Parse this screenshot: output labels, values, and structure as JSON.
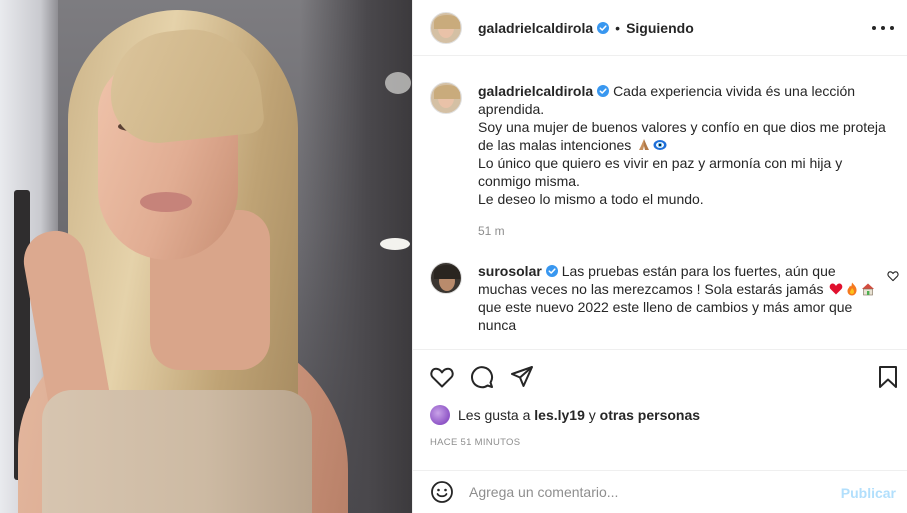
{
  "header": {
    "username": "galadrielcaldirola",
    "separator": "•",
    "follow_status": "Siguiendo"
  },
  "caption": {
    "username": "galadrielcaldirola",
    "lines": [
      "Cada experiencia vivida és una lección",
      "aprendida.",
      "Soy una mujer de buenos valores y confío en que dios me proteja",
      "de las malas intenciones",
      "Lo único que quiero es vivir en paz y armonía con mi hija y",
      "conmigo misma.",
      "Le deseo lo mismo a todo el mundo."
    ],
    "time": "51 m"
  },
  "comment": {
    "username": "surosolar",
    "lines": [
      "Las pruebas están para los fuertes, aún que",
      "muchas veces no las merezcamos ! Sola estarás jamás",
      "que este nuevo 2022 este lleno de cambios y más amor que",
      "nunca"
    ]
  },
  "likes": {
    "prefix": "Les gusta a",
    "user": "les.ly19",
    "joiner": "y",
    "others": "otras personas"
  },
  "posted_ago": "HACE 51 MINUTOS",
  "add_comment": {
    "placeholder": "Agrega un comentario...",
    "publish_label": "Publicar"
  },
  "icons": {
    "verified": "verified-badge-icon",
    "more": "more-options-icon",
    "like": "heart-icon",
    "comment": "comment-icon",
    "share": "share-icon",
    "save": "bookmark-icon",
    "emoji": "emoji-icon"
  },
  "colors": {
    "verified_blue": "#3897f0",
    "publish_disabled": "#b2dffc",
    "secondary_text": "#8e8e8e"
  }
}
